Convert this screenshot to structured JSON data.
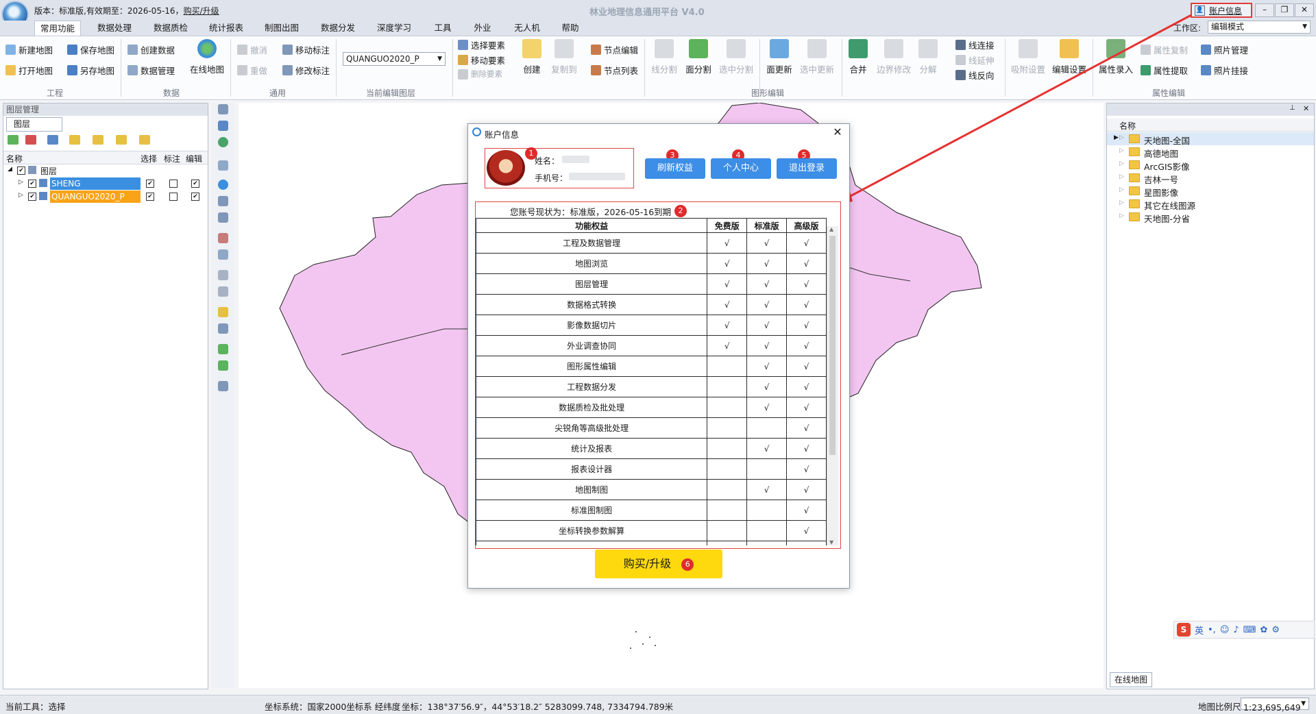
{
  "titlebar": {
    "version_text": "版本：标准版,有效期至：2026-05-16，",
    "buy_link": "购买/升级",
    "app_title": "林业地理信息通用平台 V4.0",
    "account_label": "账户信息",
    "minimize": "–",
    "restore": "❐",
    "close": "✕"
  },
  "tabs": [
    "常用功能",
    "数据处理",
    "数据质检",
    "统计报表",
    "制图出图",
    "数据分发",
    "深度学习",
    "工具",
    "外业",
    "无人机",
    "帮助"
  ],
  "workspace": {
    "label": "工作区:",
    "value": "编辑模式"
  },
  "ribbon": {
    "new_map": "新建地图",
    "open_map": "打开地图",
    "save_map": "保存地图",
    "save_as_map": "另存地图",
    "create_data": "创建数据",
    "data_manage": "数据管理",
    "online_map": "在线地图",
    "undo": "撤消",
    "redo": "重做",
    "move_label": "移动标注",
    "edit_label": "修改标注",
    "current_layer": "QUANGUO2020_P",
    "select_feature": "选择要素",
    "move_feature": "移动要素",
    "delete_feature": "删除要素",
    "create": "创建",
    "copy_to": "复制到",
    "node_edit": "节点编辑",
    "node_list": "节点列表",
    "line_split": "线分割",
    "poly_split": "面分割",
    "selected_split": "选中分割",
    "poly_update": "面更新",
    "selected_update": "选中更新",
    "merge": "合并",
    "boundary_fix": "边界修改",
    "explode": "分解",
    "line_connect": "线连接",
    "line_extend": "线延伸",
    "line_reverse": "线反向",
    "snap_settings": "吸附设置",
    "edit_settings": "编辑设置",
    "attr_input": "属性录入",
    "attr_copy": "属性复制",
    "attr_extract": "属性提取",
    "photo_manage": "照片管理",
    "photo_attach": "照片挂接",
    "groups": {
      "project": "工程",
      "data": "数据",
      "common": "通用",
      "current_layer": "当前编辑图层",
      "shape_edit": "图形编辑",
      "attr_edit": "属性编辑"
    }
  },
  "left_panel": {
    "title": "图层管理",
    "tab": "图层",
    "columns": [
      "名称",
      "选择",
      "标注",
      "编辑"
    ],
    "root": "图层",
    "layers": [
      {
        "name": "SHENG",
        "select": "✔",
        "label": "",
        "edit": "✔"
      },
      {
        "name": "QUANGUO2020_P",
        "select": "✔",
        "label": "",
        "edit": "✔"
      }
    ]
  },
  "right_panel": {
    "column": "名称",
    "items": [
      "天地图-全国",
      "高德地图",
      "ArcGIS影像",
      "吉林一号",
      "星图影像",
      "其它在线图源",
      "天地图-分省"
    ],
    "tab": "在线地图"
  },
  "statusbar": {
    "tool": "当前工具：选择",
    "coord_system": "坐标系统：国家2000坐标系 经纬度",
    "coords": "坐标：138°37′56.9″，44°53′18.2″   5283099.748, 7334794.789米",
    "scale_label": "地图比例尺",
    "scale_value": "1:23,695,649"
  },
  "ime": {
    "lang": "英"
  },
  "dialog": {
    "title": "账户信息",
    "name_label": "姓名：",
    "phone_label": "手机号：",
    "refresh": "刷新权益",
    "personal": "个人中心",
    "logout": "退出登录",
    "status_text": "您账号现状为：标准版，2026-05-16到期",
    "columns": [
      "功能权益",
      "免费版",
      "标准版",
      "高级版"
    ],
    "rows": [
      [
        "工程及数据管理",
        "√",
        "√",
        "√"
      ],
      [
        "地图浏览",
        "√",
        "√",
        "√"
      ],
      [
        "图层管理",
        "√",
        "√",
        "√"
      ],
      [
        "数据格式转换",
        "√",
        "√",
        "√"
      ],
      [
        "影像数据切片",
        "√",
        "√",
        "√"
      ],
      [
        "外业调查协同",
        "√",
        "√",
        "√"
      ],
      [
        "图形属性编辑",
        "",
        "√",
        "√"
      ],
      [
        "工程数据分发",
        "",
        "√",
        "√"
      ],
      [
        "数据质检及批处理",
        "",
        "√",
        "√"
      ],
      [
        "尖锐角等高级批处理",
        "",
        "",
        "√"
      ],
      [
        "统计及报表",
        "",
        "√",
        "√"
      ],
      [
        "报表设计器",
        "",
        "",
        "√"
      ],
      [
        "地图制图",
        "",
        "√",
        "√"
      ],
      [
        "标准图制图",
        "",
        "",
        "√"
      ],
      [
        "坐标转换参数解算",
        "",
        "",
        "√"
      ],
      [
        "",
        "",
        "",
        ""
      ]
    ],
    "buy": "购买/升级",
    "badges": [
      "1",
      "2",
      "3",
      "4",
      "5",
      "6"
    ]
  },
  "colors": {
    "accent": "#3d8ee6",
    "highlight": "#e03b3b",
    "buy": "#fdd90e",
    "map_fill": "#f3c6f1",
    "layer_sel": "#f9a319"
  }
}
